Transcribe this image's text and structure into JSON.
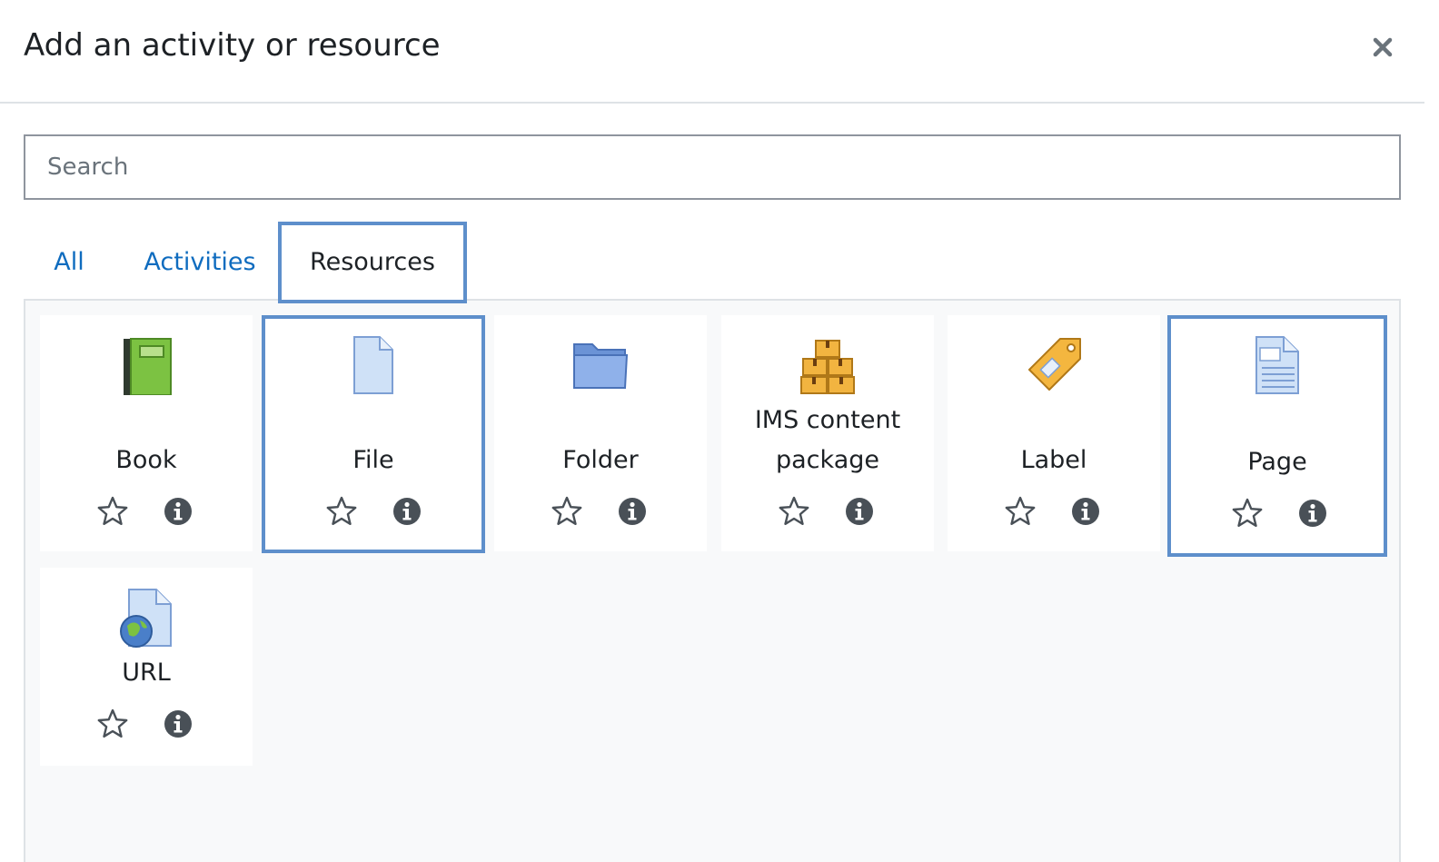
{
  "modal": {
    "title": "Add an activity or resource",
    "close_label": "×"
  },
  "search": {
    "placeholder": "Search",
    "value": ""
  },
  "tabs": [
    {
      "label": "All",
      "active": false
    },
    {
      "label": "Activities",
      "active": false
    },
    {
      "label": "Resources",
      "active": true
    }
  ],
  "items": [
    {
      "name": "Book",
      "icon": "book-icon",
      "starred": false,
      "selected": false
    },
    {
      "name": "File",
      "icon": "file-icon",
      "starred": false,
      "selected": true
    },
    {
      "name": "Folder",
      "icon": "folder-icon",
      "starred": false,
      "selected": false
    },
    {
      "name": "IMS content package",
      "name_lines": [
        "IMS content",
        "package"
      ],
      "icon": "package-icon",
      "starred": false,
      "selected": false
    },
    {
      "name": "Label",
      "icon": "label-icon",
      "starred": false,
      "selected": false
    },
    {
      "name": "Page",
      "icon": "page-icon",
      "starred": false,
      "selected": true
    },
    {
      "name": "URL",
      "icon": "url-icon",
      "starred": false,
      "selected": false
    }
  ],
  "icons": {
    "star": "star-outline-icon",
    "info": "info-circle-icon"
  },
  "colors": {
    "accent": "#0f6cbf",
    "focus_border": "#5e8fcb",
    "panel_bg": "#f8f9fa",
    "icon_gray": "#495057"
  }
}
